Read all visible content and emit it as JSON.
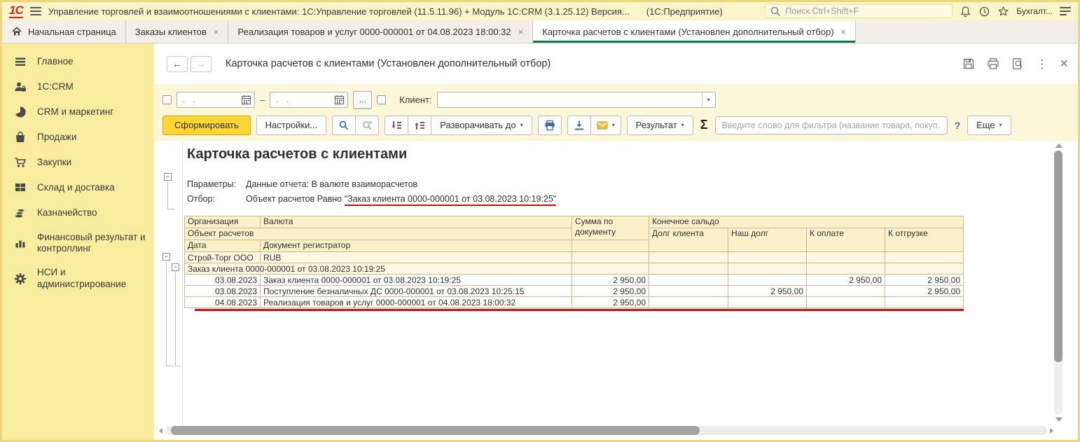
{
  "titlebar": {
    "logo": "1С",
    "title": "Управление торговлей и взаимоотношениями с клиентами: 1С:Управление торговлей (11.5.11.96) + Модуль 1С:CRM (3.1.25.12) Версия...",
    "app_label": "(1С:Предприятие)",
    "search_placeholder": "Поиск Ctrl+Shift+F",
    "user": "Бухгалт..."
  },
  "icons": {
    "close": "×",
    "dropdown": "▾",
    "collapse": "−",
    "kebab": "⋮",
    "back": "←",
    "forward": "→"
  },
  "tabs": [
    {
      "label": "Начальная страница"
    },
    {
      "label": "Заказы клиентов"
    },
    {
      "label": "Реализация товаров и услуг 0000-000001 от 04.08.2023 18:00:32"
    },
    {
      "label": "Карточка расчетов с клиентами (Установлен дополнительный отбор)"
    }
  ],
  "sidebar": {
    "items": [
      {
        "label": "Главное"
      },
      {
        "label": "1С:CRM"
      },
      {
        "label": "CRM и маркетинг"
      },
      {
        "label": "Продажи"
      },
      {
        "label": "Закупки"
      },
      {
        "label": "Склад и доставка"
      },
      {
        "label": "Казначейство"
      },
      {
        "label": "Финансовый результат и контроллинг"
      },
      {
        "label": "НСИ и администрирование"
      }
    ]
  },
  "window": {
    "title": "Карточка расчетов с клиентами (Установлен дополнительный отбор)"
  },
  "filters": {
    "date_from_placeholder": ". .",
    "date_to_placeholder": ". .",
    "dash": "–",
    "ellipsis_button": "...",
    "client_label": "Клиент:"
  },
  "toolbar": {
    "generate": "Сформировать",
    "settings": "Настройки...",
    "expand_to": "Разворачивать до",
    "result": "Результат",
    "sigma": "Σ",
    "filter_placeholder": "Введите слово для фильтра (название товара, покуп...",
    "help": "?",
    "more": "Еще"
  },
  "report": {
    "title": "Карточка расчетов с клиентами",
    "params_label": "Параметры:",
    "params_value": "Данные отчета: В валюте взаиморасчетов",
    "filter_label": "Отбор:",
    "filter_prefix": "Объект расчетов Равно ",
    "filter_value": "\"Заказ клиента 0000-000001 от 03.08.2023 10:19:25\"",
    "table": {
      "headers": {
        "org": "Организация",
        "currency": "Валюта",
        "sum": "Сумма по документу",
        "final_balance": "Конечное сальдо",
        "object": "Объект расчетов",
        "debt_client": "Долг клиента",
        "our_debt": "Наш долг",
        "to_pay": "К оплате",
        "to_ship": "К отгрузке",
        "date": "Дата",
        "registrar": "Документ регистратор"
      },
      "rows": [
        {
          "org": "Строй-Торг ООО",
          "currency": "RUB"
        },
        {
          "label": "Заказ клиента 0000-000001 от 03.08.2023 10:19:25"
        },
        {
          "date": "03.08.2023",
          "doc": "Заказ клиента 0000-000001 от 03.08.2023 10:19:25",
          "sum": "2 950,00",
          "pay": "2 950,00",
          "ship": "2 950,00"
        },
        {
          "date": "03.08.2023",
          "doc": "Поступление безналичных ДС 0000-000001 от 03.08.2023 10:25:15",
          "sum": "2 950,00",
          "our": "2 950,00",
          "ship": "2 950,00"
        },
        {
          "date": "04.08.2023",
          "doc": "Реализация товаров и услуг 0000-000001 от 04.08.2023 18:00:32",
          "sum": "2 950,00"
        }
      ]
    }
  },
  "colors": {
    "accent_green": "#15794b",
    "brand_red": "#c9252c",
    "primary_button_yellow": "#ffd633",
    "underline_red": "#cc1111",
    "panel_yellow": "#fcf7d8",
    "sidebar_yellow": "#f8ec9f"
  }
}
